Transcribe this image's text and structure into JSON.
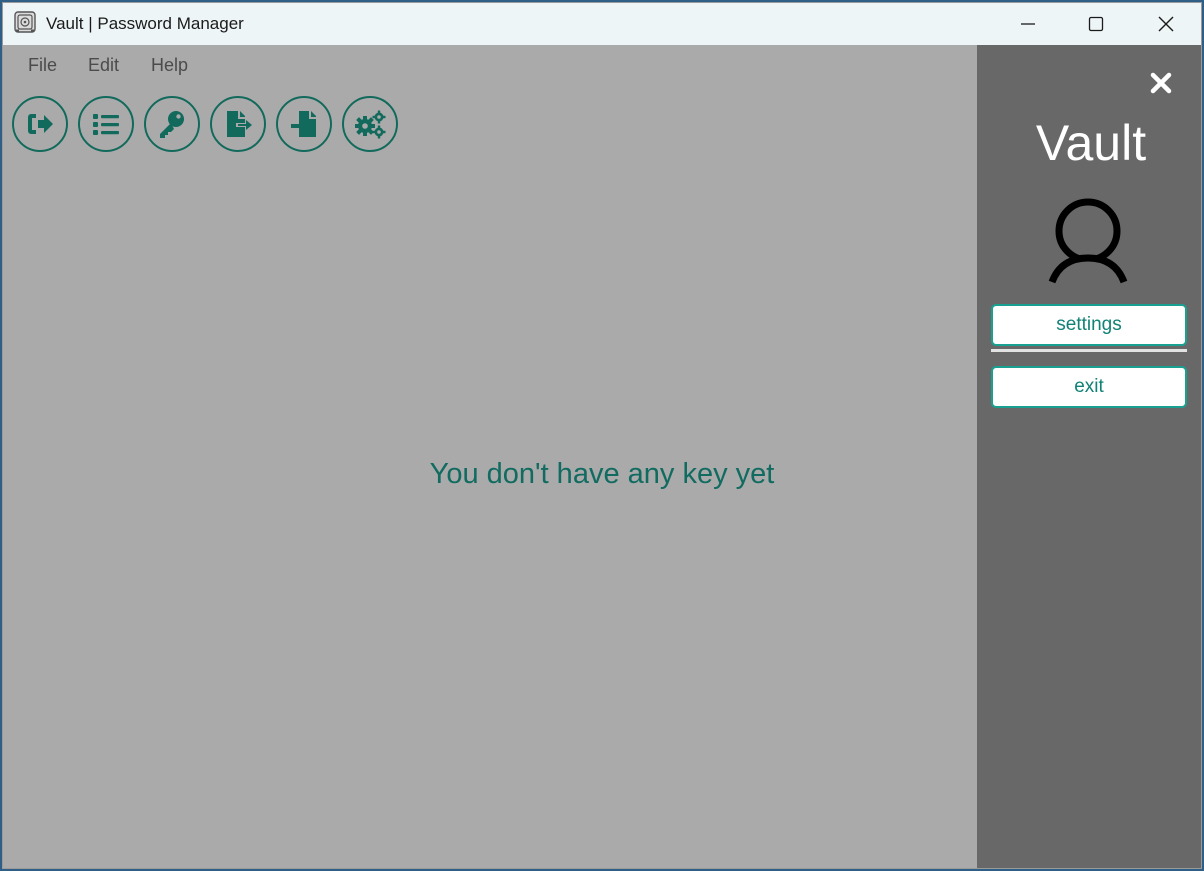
{
  "window": {
    "title": "Vault | Password Manager",
    "app_icon": "safe-icon"
  },
  "window_controls": {
    "minimize": "minimize-icon",
    "maximize": "maximize-icon",
    "close": "close-icon"
  },
  "menu": {
    "items": [
      {
        "label": "File"
      },
      {
        "label": "Edit"
      },
      {
        "label": "Help"
      }
    ]
  },
  "toolbar": {
    "buttons": [
      {
        "icon": "sign-out-icon"
      },
      {
        "icon": "list-icon"
      },
      {
        "icon": "key-icon"
      },
      {
        "icon": "file-export-icon"
      },
      {
        "icon": "file-import-icon"
      },
      {
        "icon": "gears-icon"
      }
    ]
  },
  "main": {
    "empty_message": "You don't have any key yet"
  },
  "sidebar": {
    "close_icon": "close-icon",
    "title": "Vault",
    "avatar_icon": "user-icon",
    "settings_label": "settings",
    "exit_label": "exit"
  },
  "colors": {
    "accent": "#116b60",
    "titlebar": "#eef5f6",
    "main_background": "#aaaaaa",
    "sidebar_background": "#686868",
    "button_border": "#18a090"
  }
}
